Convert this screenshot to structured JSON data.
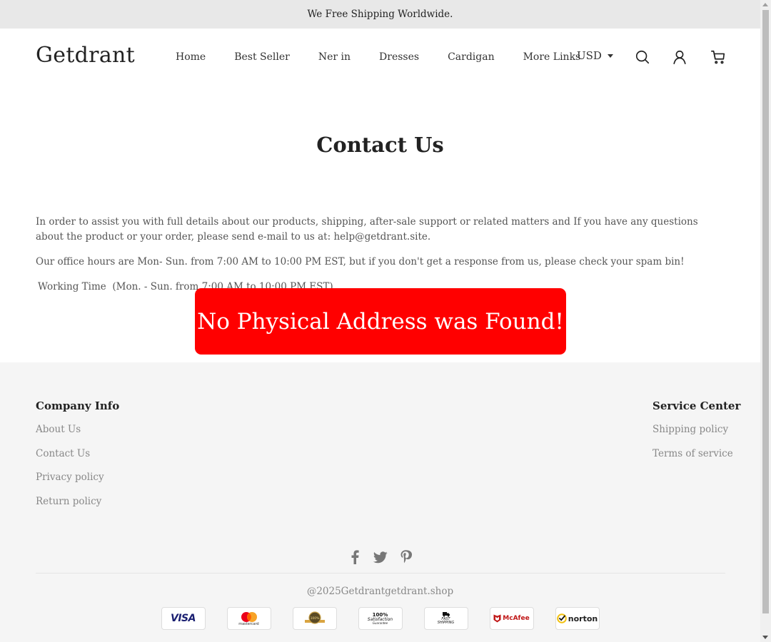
{
  "announcement": "We Free Shipping Worldwide.",
  "header": {
    "logo": "Getdrant",
    "nav": [
      "Home",
      "Best Seller",
      "Ner in",
      "Dresses",
      "Cardigan",
      "More Links"
    ],
    "currency": "USD",
    "icons": [
      "search-icon",
      "account-icon",
      "cart-icon"
    ]
  },
  "main": {
    "title": "Contact Us",
    "paragraph1": "In order to assist you with full details about our products, shipping, after-sale support or related matters and If you have any questions about the product or your order, please send e-mail to us at: help@getdrant.site.",
    "paragraph2": "Our office hours are Mon- Sun. from 7:00 AM to 10:00 PM EST, but if you don't get a response from us, please check your spam bin!",
    "working_time": "Working Time  (Mon. - Sun. from 7:00 AM to 10:00 PM EST)",
    "alert": "No Physical Address was Found!",
    "alert_color": "#ff0000"
  },
  "footer": {
    "company_info": {
      "heading": "Company Info",
      "links": [
        "About Us",
        "Contact Us",
        "Privacy policy",
        "Return policy"
      ]
    },
    "service_center": {
      "heading": "Service Center",
      "links": [
        "Shipping policy",
        "Terms of service"
      ]
    },
    "social": [
      "facebook-icon",
      "twitter-icon",
      "pinterest-icon"
    ],
    "copyright": "@2025Getdrantgetdrant.shop",
    "payments": {
      "visa": "VISA",
      "mastercard": "mastercard",
      "guarantee_seal": "100%",
      "satisfaction_top": "100%",
      "satisfaction_mid": "Satisfaction",
      "satisfaction_bot": "Guarantee",
      "fast_shipping_top": "FAST",
      "fast_shipping_bot": "SHIPPING",
      "mcafee": "McAfee",
      "norton": "norton"
    }
  }
}
